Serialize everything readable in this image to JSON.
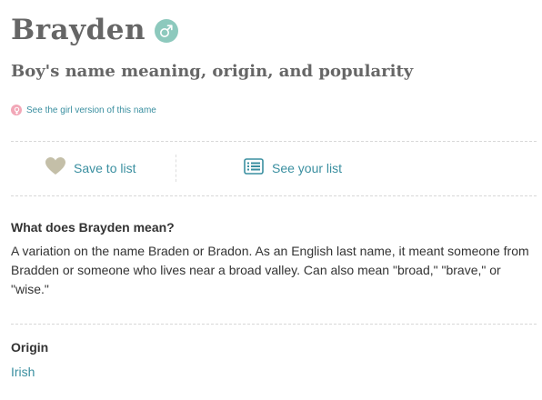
{
  "header": {
    "name": "Brayden",
    "subtitle": "Boy's name meaning, origin, and popularity",
    "gender_icon": "male-symbol-icon",
    "girl_version_link": "See the girl version of this name",
    "girl_icon": "female-symbol-icon"
  },
  "actions": {
    "save_label": "Save to list",
    "save_icon": "heart-icon",
    "see_label": "See your list",
    "see_icon": "list-icon"
  },
  "meaning": {
    "heading": "What does Brayden mean?",
    "text": "A variation on the name Braden or Bradon. As an English last name, it meant someone from Bradden or someone who lives near a broad valley. Can also mean \"broad,\" \"brave,\" or \"wise.\""
  },
  "origin": {
    "heading": "Origin",
    "value": "Irish"
  },
  "colors": {
    "accent": "#3a8fa0",
    "male_badge": "#8dc9bd",
    "female_badge": "#f2a7b7",
    "heart": "#c4bfa8",
    "heading_gray": "#666666"
  }
}
